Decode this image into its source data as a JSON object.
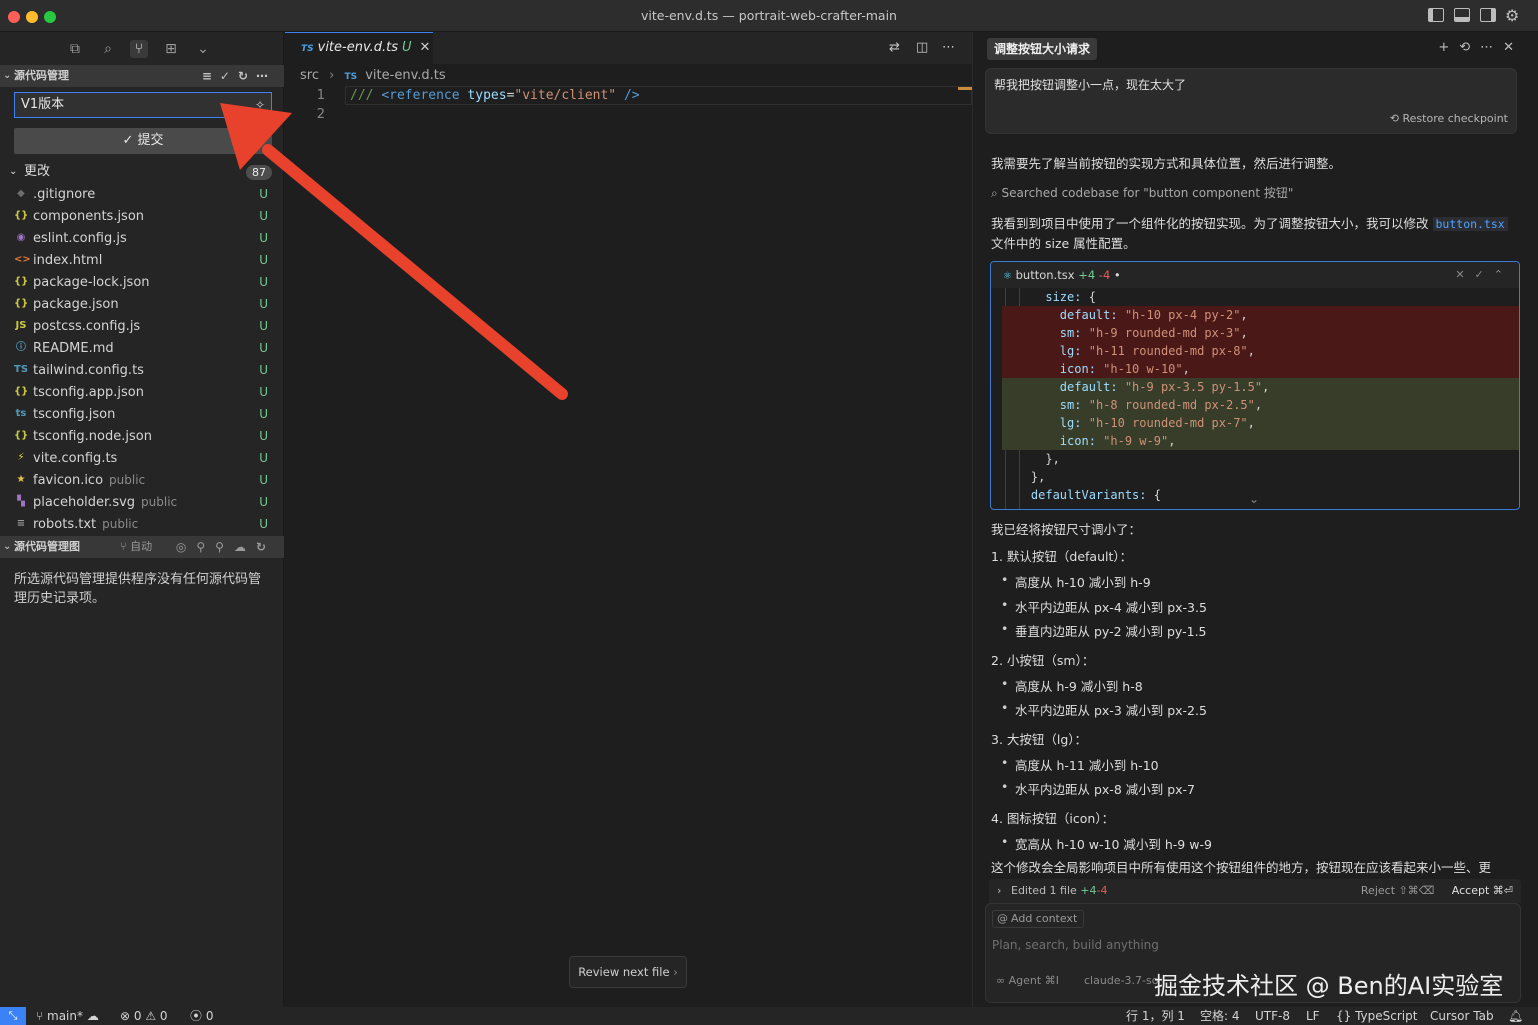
{
  "window": {
    "title": "vite-env.d.ts — portrait-web-crafter-main"
  },
  "sidebar": {
    "scm_header": "源代码管理",
    "commit_message": "V1版本",
    "commit_button": "提交",
    "changes_label": "更改",
    "changes_count": "87",
    "files": [
      {
        "name": ".gitignore",
        "dir": "",
        "status": "U",
        "icon": "git-icon",
        "glyph": "◆",
        "color": "#6d6d6d"
      },
      {
        "name": "components.json",
        "dir": "",
        "status": "U",
        "icon": "json-icon",
        "glyph": "{}",
        "color": "#cbcb41"
      },
      {
        "name": "eslint.config.js",
        "dir": "",
        "status": "U",
        "icon": "eslint-icon",
        "glyph": "◉",
        "color": "#a074c4"
      },
      {
        "name": "index.html",
        "dir": "",
        "status": "U",
        "icon": "html-icon",
        "glyph": "<>",
        "color": "#e37933"
      },
      {
        "name": "package-lock.json",
        "dir": "",
        "status": "U",
        "icon": "json-icon",
        "glyph": "{}",
        "color": "#cbcb41"
      },
      {
        "name": "package.json",
        "dir": "",
        "status": "U",
        "icon": "json-icon",
        "glyph": "{}",
        "color": "#cbcb41"
      },
      {
        "name": "postcss.config.js",
        "dir": "",
        "status": "U",
        "icon": "js-icon",
        "glyph": "JS",
        "color": "#cbcb41"
      },
      {
        "name": "README.md",
        "dir": "",
        "status": "U",
        "icon": "info-icon",
        "glyph": "ⓘ",
        "color": "#519aba"
      },
      {
        "name": "tailwind.config.ts",
        "dir": "",
        "status": "U",
        "icon": "ts-icon",
        "glyph": "TS",
        "color": "#519aba"
      },
      {
        "name": "tsconfig.app.json",
        "dir": "",
        "status": "U",
        "icon": "json-icon",
        "glyph": "{}",
        "color": "#cbcb41"
      },
      {
        "name": "tsconfig.json",
        "dir": "",
        "status": "U",
        "icon": "tsconfig-icon",
        "glyph": "ts",
        "color": "#519aba"
      },
      {
        "name": "tsconfig.node.json",
        "dir": "",
        "status": "U",
        "icon": "json-icon",
        "glyph": "{}",
        "color": "#cbcb41"
      },
      {
        "name": "vite.config.ts",
        "dir": "",
        "status": "U",
        "icon": "vite-icon",
        "glyph": "⚡",
        "color": "#e8d44d"
      },
      {
        "name": "favicon.ico",
        "dir": "public",
        "status": "U",
        "icon": "star-icon",
        "glyph": "★",
        "color": "#e8c547"
      },
      {
        "name": "placeholder.svg",
        "dir": "public",
        "status": "U",
        "icon": "svg-icon",
        "glyph": "▚",
        "color": "#a074c4"
      },
      {
        "name": "robots.txt",
        "dir": "public",
        "status": "U",
        "icon": "text-file-icon",
        "glyph": "≡",
        "color": "#9a9a9a"
      }
    ],
    "graph_header": "源代码管理图",
    "graph_auto": "自动",
    "graph_empty": "所选源代码管理提供程序没有任何源代码管理历史记录项。"
  },
  "editor": {
    "tab_lang": "TS",
    "tab_name": "vite-env.d.ts",
    "tab_status": "U",
    "breadcrumb_dir": "src",
    "breadcrumb_lang": "TS",
    "breadcrumb_file": "vite-env.d.ts",
    "line_numbers": [
      "1",
      "2"
    ],
    "code": {
      "comment": "///",
      "tag_open": "<reference",
      "attr": "types",
      "eq": "=",
      "value": "\"vite/client\"",
      "tag_close": "/>"
    },
    "review_button": "Review next file"
  },
  "chat": {
    "title": "调整按钮大小请求",
    "user_message": "帮我把按钮调整小一点，现在太大了",
    "restore": "Restore checkpoint",
    "p1": "我需要先了解当前按钮的实现方式和具体位置，然后进行调整。",
    "search": "Searched codebase for \"button component 按钮\"",
    "p2a": "我看到到项目中使用了一个组件化的按钮实现。为了调整按钮大小，我可以修改",
    "p2code": "button.tsx",
    "p2b": "文件中的 size 属性配置。",
    "diff": {
      "file": "button.tsx",
      "added": "+4",
      "removed": "-4",
      "dot": "•",
      "lines": [
        {
          "kind": "ctx",
          "indent": "      ",
          "key": "size:",
          "val": "",
          "tail": " {"
        },
        {
          "kind": "del",
          "indent": "        ",
          "key": "default:",
          "val": "\"h-10 px-4 py-2\"",
          "tail": ","
        },
        {
          "kind": "del",
          "indent": "        ",
          "key": "sm:",
          "val": "\"h-9 rounded-md px-3\"",
          "tail": ","
        },
        {
          "kind": "del",
          "indent": "        ",
          "key": "lg:",
          "val": "\"h-11 rounded-md px-8\"",
          "tail": ","
        },
        {
          "kind": "del",
          "indent": "        ",
          "key": "icon:",
          "val": "\"h-10 w-10\"",
          "tail": ","
        },
        {
          "kind": "add",
          "indent": "        ",
          "key": "default:",
          "val": "\"h-9 px-3.5 py-1.5\"",
          "tail": ","
        },
        {
          "kind": "add",
          "indent": "        ",
          "key": "sm:",
          "val": "\"h-8 rounded-md px-2.5\"",
          "tail": ","
        },
        {
          "kind": "add",
          "indent": "        ",
          "key": "lg:",
          "val": "\"h-10 rounded-md px-7\"",
          "tail": ","
        },
        {
          "kind": "add",
          "indent": "        ",
          "key": "icon:",
          "val": "\"h-9 w-9\"",
          "tail": ","
        },
        {
          "kind": "ctx",
          "indent": "      ",
          "key": "",
          "val": "",
          "tail": "},"
        },
        {
          "kind": "ctx",
          "indent": "    ",
          "key": "",
          "val": "",
          "tail": "},"
        },
        {
          "kind": "ctx",
          "indent": "    ",
          "key": "defaultVariants:",
          "val": "",
          "tail": " {"
        }
      ]
    },
    "p3": "我已经将按钮尺寸调小了：",
    "list": [
      {
        "title": "1. 默认按钮（default）：",
        "items": [
          "高度从 h-10 减小到 h-9",
          "水平内边距从 px-4 减小到 px-3.5",
          "垂直内边距从 py-2 减小到 py-1.5"
        ]
      },
      {
        "title": "2. 小按钮（sm）：",
        "items": [
          "高度从 h-9 减小到 h-8",
          "水平内边距从 px-3 减小到 px-2.5"
        ]
      },
      {
        "title": "3. 大按钮（lg）：",
        "items": [
          "高度从 h-11 减小到 h-10",
          "水平内边距从 px-8 减小到 px-7"
        ]
      },
      {
        "title": "4. 图标按钮（icon）：",
        "items": [
          "宽高从 h-10 w-10 减小到 h-9 w-9"
        ]
      }
    ],
    "p4": "这个修改会全局影响项目中所有使用这个按钮组件的地方，按钮现在应该看起来小一些、更",
    "edited": "Edited 1 file",
    "edited_added": "+4",
    "edited_removed": "-4",
    "reject": "Reject ⇧⌘⌫",
    "accept": "Accept ⌘⏎",
    "add_context": "Add context",
    "placeholder": "Plan, search, build anything",
    "agent": "∞ Agent ⌘I",
    "model": "claude-3.7-so"
  },
  "watermark": "掘金技术社区 @ Ben的AI实验室",
  "statusbar": {
    "branch": "main*",
    "errors": "0",
    "warnings": "0",
    "ports": "0",
    "position": "行 1，列 1",
    "spaces": "空格: 4",
    "encoding": "UTF-8",
    "eol": "LF",
    "language": "TypeScript",
    "cursor_tab": "Cursor Tab"
  },
  "colors": {
    "accent": "#3b82f6",
    "untracked": "#73c991",
    "arrow": "#e8412c"
  }
}
